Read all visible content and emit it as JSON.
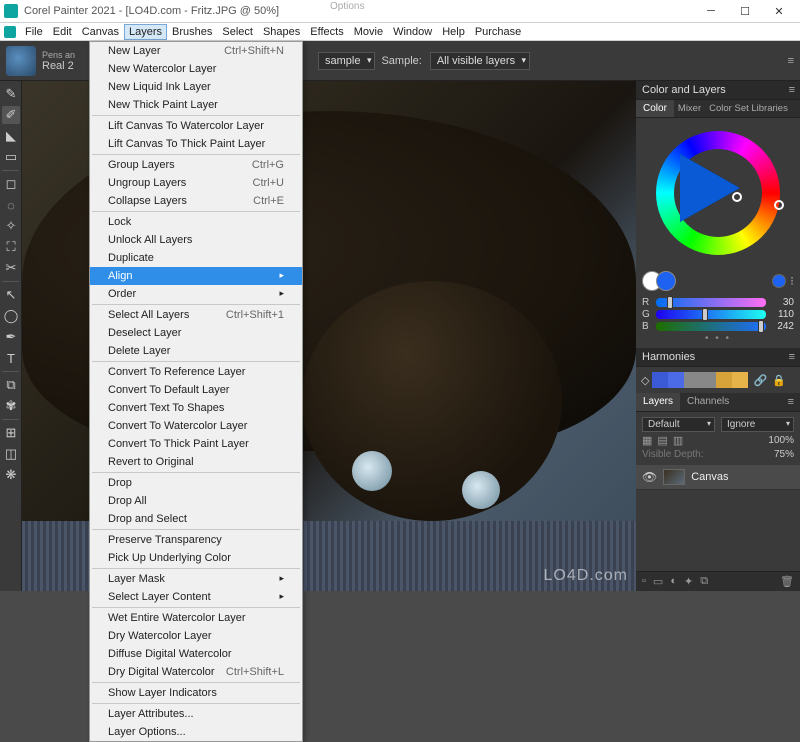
{
  "window": {
    "title": "Corel Painter 2021 - [LO4D.com - Fritz.JPG @ 50%]"
  },
  "menubar": [
    "File",
    "Edit",
    "Canvas",
    "Layers",
    "Brushes",
    "Select",
    "Shapes",
    "Effects",
    "Movie",
    "Window",
    "Help",
    "Purchase"
  ],
  "menubar_active_index": 3,
  "optionsbar": {
    "title": "Options",
    "brush_category": "Pens an",
    "brush_name": "Real 2",
    "sample_dd": "sample",
    "sample_label": "Sample:",
    "sample_value": "All visible layers"
  },
  "layers_menu": [
    {
      "t": "item",
      "label": "New Layer",
      "shortcut": "Ctrl+Shift+N"
    },
    {
      "t": "item",
      "label": "New Watercolor Layer"
    },
    {
      "t": "item",
      "label": "New Liquid Ink Layer"
    },
    {
      "t": "item",
      "label": "New Thick Paint Layer"
    },
    {
      "t": "sep"
    },
    {
      "t": "item",
      "label": "Lift Canvas To Watercolor Layer"
    },
    {
      "t": "item",
      "label": "Lift Canvas To Thick Paint Layer"
    },
    {
      "t": "sep"
    },
    {
      "t": "item",
      "label": "Group Layers",
      "shortcut": "Ctrl+G"
    },
    {
      "t": "item",
      "label": "Ungroup Layers",
      "shortcut": "Ctrl+U"
    },
    {
      "t": "item",
      "label": "Collapse Layers",
      "shortcut": "Ctrl+E"
    },
    {
      "t": "sep"
    },
    {
      "t": "item",
      "label": "Lock"
    },
    {
      "t": "item",
      "label": "Unlock All Layers"
    },
    {
      "t": "item",
      "label": "Duplicate"
    },
    {
      "t": "item",
      "label": "Align",
      "submenu": true,
      "highlight": true
    },
    {
      "t": "item",
      "label": "Order",
      "submenu": true
    },
    {
      "t": "sep"
    },
    {
      "t": "item",
      "label": "Select All Layers",
      "shortcut": "Ctrl+Shift+1"
    },
    {
      "t": "item",
      "label": "Deselect Layer"
    },
    {
      "t": "item",
      "label": "Delete Layer"
    },
    {
      "t": "sep"
    },
    {
      "t": "item",
      "label": "Convert To Reference Layer"
    },
    {
      "t": "item",
      "label": "Convert To Default Layer"
    },
    {
      "t": "item",
      "label": "Convert Text To Shapes"
    },
    {
      "t": "item",
      "label": "Convert To Watercolor Layer"
    },
    {
      "t": "item",
      "label": "Convert To Thick Paint Layer"
    },
    {
      "t": "item",
      "label": "Revert to Original"
    },
    {
      "t": "sep"
    },
    {
      "t": "item",
      "label": "Drop"
    },
    {
      "t": "item",
      "label": "Drop All"
    },
    {
      "t": "item",
      "label": "Drop and Select"
    },
    {
      "t": "sep"
    },
    {
      "t": "item",
      "label": "Preserve Transparency"
    },
    {
      "t": "item",
      "label": "Pick Up Underlying Color"
    },
    {
      "t": "sep"
    },
    {
      "t": "item",
      "label": "Layer Mask",
      "submenu": true
    },
    {
      "t": "item",
      "label": "Select Layer Content",
      "submenu": true
    },
    {
      "t": "sep"
    },
    {
      "t": "item",
      "label": "Wet Entire Watercolor Layer"
    },
    {
      "t": "item",
      "label": "Dry Watercolor Layer"
    },
    {
      "t": "item",
      "label": "Diffuse Digital Watercolor"
    },
    {
      "t": "item",
      "label": "Dry Digital Watercolor",
      "shortcut": "Ctrl+Shift+L"
    },
    {
      "t": "sep"
    },
    {
      "t": "item",
      "label": "Show Layer Indicators"
    },
    {
      "t": "sep"
    },
    {
      "t": "item",
      "label": "Layer Attributes..."
    },
    {
      "t": "item",
      "label": "Layer Options..."
    }
  ],
  "right": {
    "panel1_title": "Color and Layers",
    "color_tabs": [
      "Color",
      "Mixer",
      "Color Set Libraries"
    ],
    "fg_color": "#1e62f2",
    "bg_color": "#ffffff",
    "rgb": {
      "r": 30,
      "g": 110,
      "b": 242
    },
    "harmonies_title": "Harmonies",
    "harmony_swatches": [
      "#3a5ad6",
      "#4a6ae6",
      "#888888",
      "#888888",
      "#d6a23a",
      "#e6b24a"
    ],
    "layers_tabs": [
      "Layers",
      "Channels"
    ],
    "blend_mode": "Default",
    "mask_mode": "Ignore",
    "opacity_label": "",
    "opacity": "100%",
    "depth_label": "Visible Depth:",
    "depth": "75%",
    "canvas_layer": "Canvas"
  },
  "watermark": "LO4D.com"
}
